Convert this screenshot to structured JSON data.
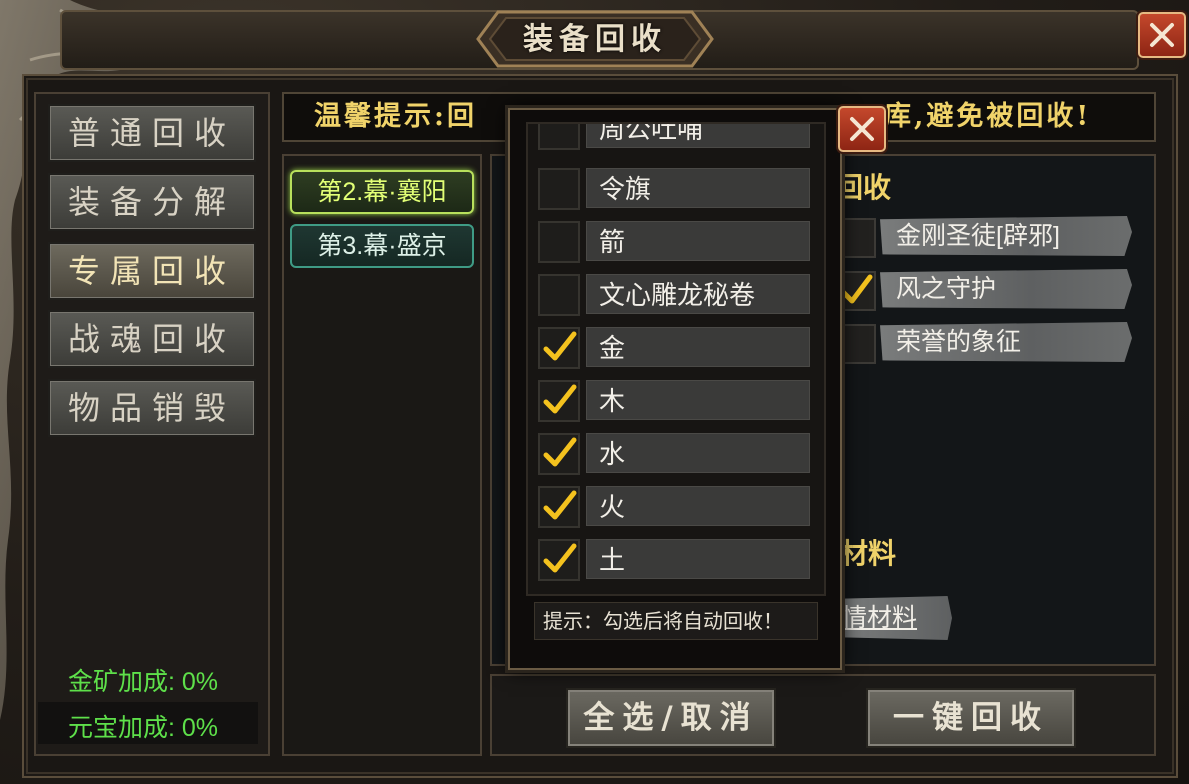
{
  "window": {
    "title": "装备回收"
  },
  "left_menu": {
    "items": [
      {
        "label": "普通回收",
        "active": false
      },
      {
        "label": "装备分解",
        "active": false
      },
      {
        "label": "专属回收",
        "active": true
      },
      {
        "label": "战魂回收",
        "active": false
      },
      {
        "label": "物品销毁",
        "active": false
      }
    ],
    "gold_bonus": "金矿加成: 0%",
    "yuanbao_bonus": "元宝加成: 0%"
  },
  "tip": {
    "text_left": "温馨提示:回",
    "text_right": "库,避免被回收!"
  },
  "chapters": [
    {
      "label": "第2.幕·襄阳",
      "selected": true
    },
    {
      "label": "第3.幕·盛京",
      "selected": false
    }
  ],
  "right_section": {
    "title_fragment": "回收",
    "items": [
      {
        "label": "金刚圣徒[辟邪]",
        "checked": false
      },
      {
        "label": "风之守护",
        "checked": true
      },
      {
        "label": "荣誉的象征",
        "checked": false
      }
    ],
    "title2_fragment": "材料",
    "extra_fragment": "情材料"
  },
  "bottom": {
    "select_all_label": "全选/取消",
    "recycle_label": "一键回收"
  },
  "popup": {
    "items": [
      {
        "label": "周公吐哺",
        "checked": false
      },
      {
        "label": "令旗",
        "checked": false
      },
      {
        "label": "箭",
        "checked": false
      },
      {
        "label": "文心雕龙秘卷",
        "checked": false
      },
      {
        "label": "金",
        "checked": true
      },
      {
        "label": "木",
        "checked": true
      },
      {
        "label": "水",
        "checked": true
      },
      {
        "label": "火",
        "checked": true
      },
      {
        "label": "土",
        "checked": true
      }
    ],
    "hint": "提示：勾选后将自动回收！"
  },
  "colors": {
    "tip_yellow": "#f0d36a",
    "bonus_green": "#5ee04a",
    "check_gold": "#f4c21e",
    "close_red": "#b23a20"
  },
  "icons": {
    "close": "close-icon",
    "check": "check-icon",
    "dragon": "dragon-ornament-icon"
  }
}
